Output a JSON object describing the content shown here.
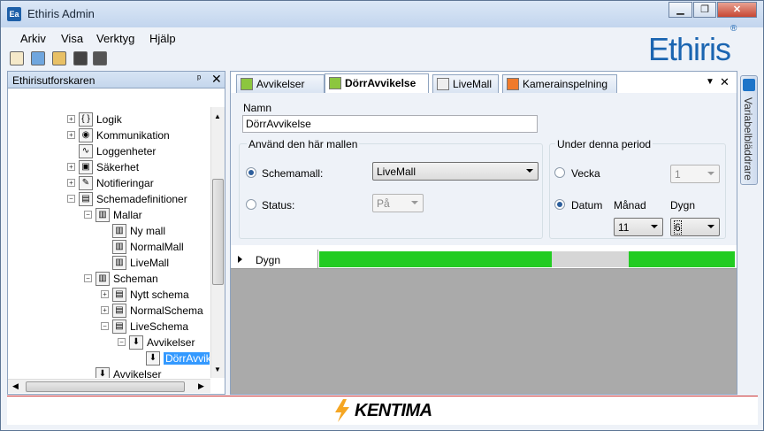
{
  "window": {
    "app_icon": "Ea",
    "title": "Ethiris Admin",
    "logo": "Ethiris",
    "logo_mark": "®"
  },
  "menu": [
    "Arkiv",
    "Visa",
    "Verktyg",
    "Hjälp"
  ],
  "toolbar_icons": [
    "new-icon",
    "settings-icon",
    "folder-open-icon",
    "save-icon",
    "save-all-icon"
  ],
  "explorer": {
    "title": "Ethirisutforskaren",
    "pin": "ᵖ",
    "close": "✕",
    "nodes": [
      {
        "label": "Logik",
        "icon": "{ }"
      },
      {
        "label": "Kommunikation",
        "icon": "◉"
      },
      {
        "label": "Loggenheter",
        "icon": "∿"
      },
      {
        "label": "Säkerhet",
        "icon": "▣"
      },
      {
        "label": "Notifieringar",
        "icon": "✎"
      },
      {
        "label": "Schemadefinitioner",
        "icon": "▤"
      },
      {
        "label": "Mallar",
        "icon": "▥"
      },
      {
        "label": "Ny mall",
        "icon": "▥"
      },
      {
        "label": "NormalMall",
        "icon": "▥"
      },
      {
        "label": "LiveMall",
        "icon": "▥"
      },
      {
        "label": "Scheman",
        "icon": "▥"
      },
      {
        "label": "Nytt schema",
        "icon": "▤"
      },
      {
        "label": "NormalSchema",
        "icon": "▤"
      },
      {
        "label": "LiveSchema",
        "icon": "▤"
      },
      {
        "label": "Avvikelser",
        "icon": "⬇"
      },
      {
        "label": "DörrAvvik",
        "icon": "⬇"
      },
      {
        "label": "Avvikelser",
        "icon": "⬇"
      }
    ]
  },
  "tabs": [
    {
      "label": "Avvikelser"
    },
    {
      "label": "DörrAvvikelse"
    },
    {
      "label": "LiveMall"
    },
    {
      "label": "Kamerainspelning"
    }
  ],
  "form": {
    "name_label": "Namn",
    "name_value": "DörrAvvikelse",
    "template_group": "Använd den här mallen",
    "schedule_template_label": "Schemamall:",
    "schedule_template_value": "LiveMall",
    "status_label": "Status:",
    "status_value": "På",
    "period_group": "Under denna period",
    "week_label": "Vecka",
    "week_value": "1",
    "date_label": "Datum",
    "month_label": "Månad",
    "day_label": "Dygn",
    "month_value": "11",
    "day_value": "6"
  },
  "schedule": {
    "row_label": "Dygn",
    "segments": [
      {
        "state": "on",
        "from": 0,
        "to": 0.56,
        "color": "#22cc22"
      },
      {
        "state": "off",
        "from": 0.56,
        "to": 0.745,
        "color": "#d6d6d6"
      },
      {
        "state": "on",
        "from": 0.745,
        "to": 1.0,
        "color": "#22cc22"
      }
    ]
  },
  "side_panel": {
    "label": "Variabelbläddrare"
  },
  "footer": {
    "brand": "KENTIMA"
  }
}
